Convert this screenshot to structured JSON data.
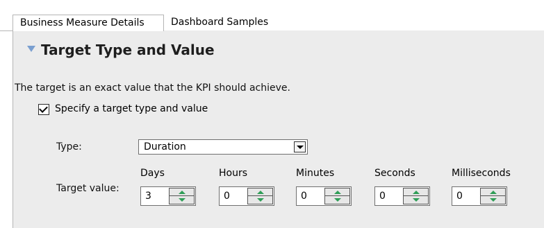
{
  "tabs": [
    {
      "label": "Business Measure Details",
      "active": true
    },
    {
      "label": "Dashboard Samples",
      "active": false
    }
  ],
  "section": {
    "title": "Target Type and Value",
    "collapse_icon": "triangle-down-icon",
    "description": "The target is an exact value that the KPI should achieve.",
    "checkbox": {
      "label": "Specify a target type and value",
      "checked": true
    },
    "type": {
      "label": "Type:",
      "selected": "Duration"
    },
    "target_value": {
      "label": "Target value:",
      "fields": [
        {
          "unit": "Days",
          "value": "3"
        },
        {
          "unit": "Hours",
          "value": "0"
        },
        {
          "unit": "Minutes",
          "value": "0"
        },
        {
          "unit": "Seconds",
          "value": "0"
        },
        {
          "unit": "Milliseconds",
          "value": "0"
        }
      ]
    }
  },
  "colors": {
    "panel_bg": "#ececec",
    "accent_triangle": "#7a9fd0",
    "spinner_arrow": "#2f9e57"
  }
}
